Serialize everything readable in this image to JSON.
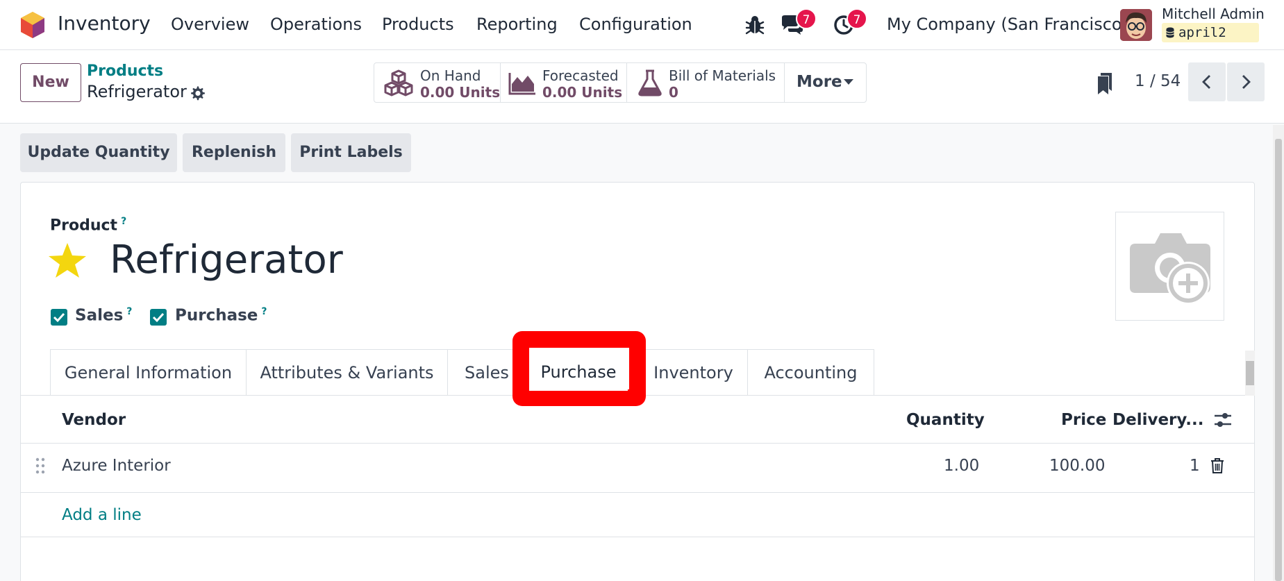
{
  "navbar": {
    "app_name": "Inventory",
    "menu": [
      "Overview",
      "Operations",
      "Products",
      "Reporting",
      "Configuration"
    ],
    "messages_count": "7",
    "activities_count": "7",
    "company": "My Company (San Francisco)",
    "user_name": "Mitchell Admin",
    "database": "april2",
    "icons": [
      "bug-icon",
      "chat-icon",
      "clock-icon"
    ]
  },
  "control": {
    "new_label": "New",
    "breadcrumb_parent": "Products",
    "breadcrumb_current": "Refrigerator",
    "smart_buttons": [
      {
        "label": "On Hand",
        "value": "0.00 Units",
        "icon": "boxes-icon"
      },
      {
        "label": "Forecasted",
        "value": "0.00 Units",
        "icon": "area-chart-icon"
      },
      {
        "label": "Bill of Materials",
        "value": "0",
        "icon": "flask-icon"
      }
    ],
    "more_label": "More",
    "pager": "1 / 54"
  },
  "actions": [
    "Update Quantity",
    "Replenish",
    "Print Labels"
  ],
  "form": {
    "product_label": "Product",
    "help_mark": "?",
    "product_name": "Refrigerator",
    "favorite": true,
    "sales_label": "Sales",
    "purchase_label": "Purchase",
    "sales_checked": true,
    "purchase_checked": true
  },
  "tabs": {
    "items": [
      "General Information",
      "Attributes & Variants",
      "Sales",
      "Purchase",
      "Inventory",
      "Accounting"
    ],
    "active": "Purchase"
  },
  "vendor_table": {
    "headers": {
      "vendor": "Vendor",
      "quantity": "Quantity",
      "price": "Price",
      "delivery": "Delivery..."
    },
    "rows": [
      {
        "vendor": "Azure Interior",
        "quantity": "1.00",
        "price": "100.00",
        "delivery": "1"
      }
    ],
    "add_line": "Add a line"
  },
  "colors": {
    "brand": "#714b67",
    "teal": "#017e84",
    "badge": "#e5154c",
    "highlight": "#ff0000",
    "star": "#f3d60f"
  }
}
